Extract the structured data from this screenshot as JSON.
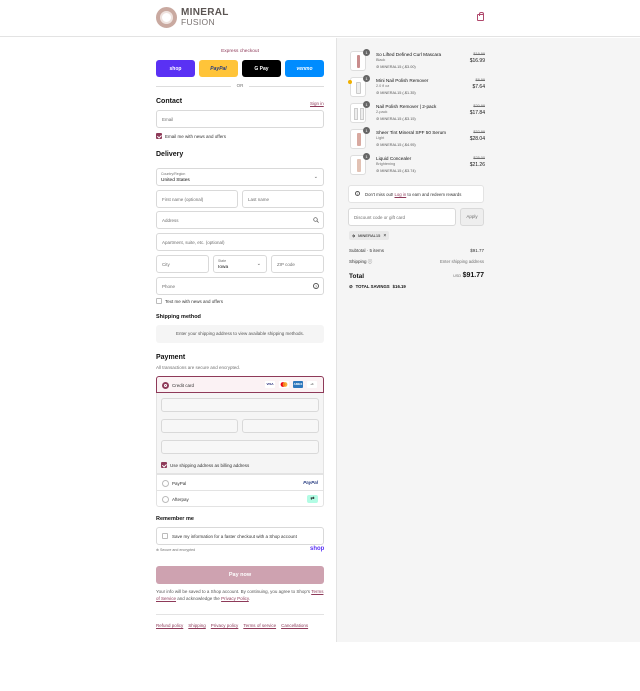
{
  "brand": {
    "line1": "MINERAL",
    "line2": "FUSION"
  },
  "express": {
    "label": "Express checkout",
    "or": "OR",
    "buttons": [
      {
        "label": "shop",
        "bg": "#5a31f4",
        "color": "#ffffff"
      },
      {
        "label": "PayPal",
        "bg": "#ffc439",
        "color": "#253b80"
      },
      {
        "label": "G Pay",
        "bg": "#000000",
        "color": "#ffffff"
      },
      {
        "label": "venmo",
        "bg": "#008cff",
        "color": "#ffffff"
      }
    ]
  },
  "contact": {
    "title": "Contact",
    "sign_in": "Sign in",
    "email_placeholder": "Email",
    "news_label": "Email me with news and offers"
  },
  "delivery": {
    "title": "Delivery",
    "country_label": "Country/Region",
    "country_value": "United States",
    "first_name": "First name (optional)",
    "last_name": "Last name",
    "address": "Address",
    "apartment": "Apartment, suite, etc. (optional)",
    "city": "City",
    "state_label": "State",
    "state_value": "Iowa",
    "zip": "ZIP code",
    "phone": "Phone",
    "text_label": "Text me with news and offers"
  },
  "shipping": {
    "title": "Shipping method",
    "message": "Enter your shipping address to view available shipping methods."
  },
  "payment": {
    "title": "Payment",
    "subtitle": "All transactions are secure and encrypted.",
    "credit_card": "Credit card",
    "billing_label": "Use shipping address as billing address",
    "paypal": "PayPal",
    "afterpay": "Afterpay",
    "card_logos": {
      "visa": "VISA",
      "amex": "AMEX",
      "more": "+1"
    }
  },
  "remember": {
    "title": "Remember me",
    "label": "Save my information for a faster checkout with a Shop account",
    "secure": "Secure and encrypted",
    "shop": "shop"
  },
  "pay_now": "Pay now",
  "legal": {
    "text1": "Your info will be saved to a Shop account. By continuing, you agree to Shop's",
    "terms": "Terms of Service",
    "text2": "and acknowledge the",
    "privacy": "Privacy Policy",
    "end": "."
  },
  "footer_links": [
    "Refund policy",
    "Shipping",
    "Privacy policy",
    "Terms of service",
    "Cancellations"
  ],
  "cart": {
    "items": [
      {
        "qty": "1",
        "name": "So Lifted Defined Curl Mascara",
        "variant": "Black",
        "discount": "MINERAL15 (-$3.00)",
        "old": "$19.99",
        "new": "$16.99"
      },
      {
        "qty": "1",
        "name": "Mini Nail Polish Remover",
        "variant": "2.0 fl oz",
        "discount": "MINERAL15 (-$1.35)",
        "old": "$8.99",
        "new": "$7.64"
      },
      {
        "qty": "1",
        "name": "Nail Polish Remover | 2-pack",
        "variant": "2-pack",
        "discount": "MINERAL15 (-$3.15)",
        "old": "$20.99",
        "new": "$17.84"
      },
      {
        "qty": "1",
        "name": "Sheer Tint Mineral SPF 50 Serum",
        "variant": "Light",
        "discount": "MINERAL15 (-$4.95)",
        "old": "$32.99",
        "new": "$28.04"
      },
      {
        "qty": "1",
        "name": "Liquid Concealer",
        "variant": "Brightening",
        "discount": "MINERAL15 (-$3.74)",
        "old": "$25.00",
        "new": "$21.26"
      }
    ],
    "rewards_text": "Don't miss out!",
    "rewards_link": "Log in",
    "rewards_rest": "to earn and redeem rewards",
    "discount_placeholder": "Discount code or gift card",
    "apply": "Apply",
    "code_tag": "MINERAL15",
    "subtotal_label": "Subtotal · 5 items",
    "subtotal": "$91.77",
    "shipping_label": "Shipping",
    "shipping_value": "Enter shipping address",
    "total_label": "Total",
    "currency": "USD",
    "total": "$91.77",
    "savings_label": "TOTAL SAVINGS",
    "savings": "$16.19"
  }
}
